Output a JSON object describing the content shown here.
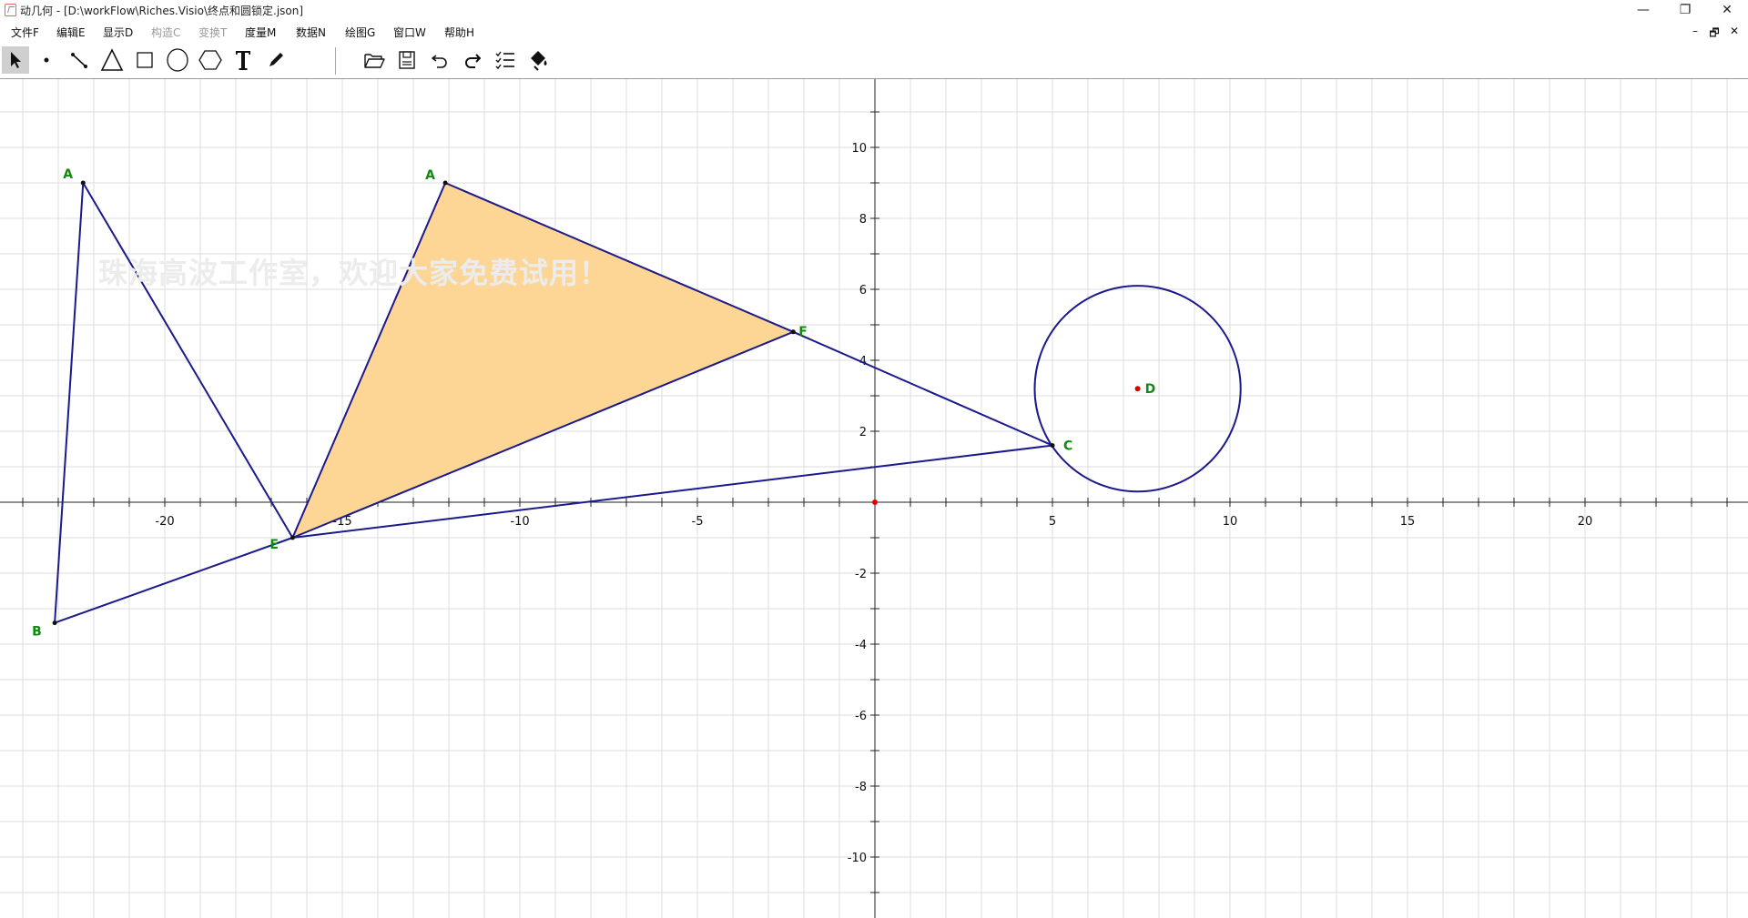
{
  "window": {
    "title": "动几何 - [D:\\workFlow\\Riches.Visio\\终点和圆锁定.json]",
    "controls": [
      "—",
      "❐",
      "✕"
    ]
  },
  "menu": {
    "items": [
      {
        "label": "文件F",
        "enabled": true
      },
      {
        "label": "编辑E",
        "enabled": true
      },
      {
        "label": "显示D",
        "enabled": true
      },
      {
        "label": "构造C",
        "enabled": false
      },
      {
        "label": "变换T",
        "enabled": false
      },
      {
        "label": "度量M",
        "enabled": true
      },
      {
        "label": "数据N",
        "enabled": true
      },
      {
        "label": "绘图G",
        "enabled": true
      },
      {
        "label": "窗口W",
        "enabled": true
      },
      {
        "label": "帮助H",
        "enabled": true
      }
    ],
    "mdi_controls": [
      "–",
      "🗗",
      "✕"
    ]
  },
  "toolbar": {
    "tools": [
      "select-arrow-icon",
      "point-icon",
      "segment-icon",
      "triangle-icon",
      "rectangle-icon",
      "circle-icon",
      "hexagon-icon",
      "text-tool-icon",
      "pencil-icon",
      "open-folder-icon",
      "save-icon",
      "undo-icon",
      "redo-icon",
      "checklist-icon",
      "paint-bucket-icon"
    ],
    "selected": "select-arrow-icon"
  },
  "canvas": {
    "watermark": "珠海高波工作室，欢迎大家免费试用！",
    "x_ticks": [
      "-20",
      "-15",
      "-10",
      "-5",
      "5",
      "10",
      "15",
      "20"
    ],
    "y_ticks": [
      "10",
      "8",
      "6",
      "4",
      "2",
      "-2",
      "-4",
      "-6",
      "-8",
      "-10"
    ],
    "colors": {
      "grid": "#dcdcdc",
      "axis": "#222222",
      "shape": "#1a1a8c",
      "fill": "#fdd594",
      "label": "#118a11",
      "center": "#dd0000"
    },
    "points": [
      {
        "name": "A",
        "x": -22.3,
        "y": 9.0
      },
      {
        "name": "B",
        "x": -23.1,
        "y": -3.4
      },
      {
        "name": "E",
        "x": -16.4,
        "y": -1.0
      },
      {
        "name": "A",
        "x": -12.1,
        "y": 9.0
      },
      {
        "name": "F",
        "x": -2.3,
        "y": 4.8
      },
      {
        "name": "C",
        "x": 5.0,
        "y": 1.6
      },
      {
        "name": "D",
        "x": 7.4,
        "y": 3.2
      }
    ],
    "circle": {
      "center": "D",
      "radius": 2.9
    }
  }
}
